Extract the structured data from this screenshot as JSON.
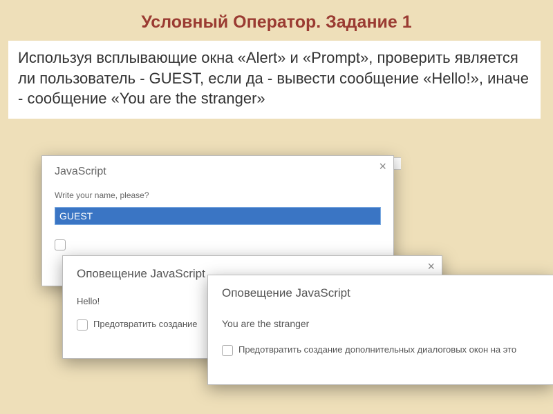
{
  "slide": {
    "title": "Условный Оператор. Задание 1",
    "task_text": "Используя  всплывающие окна «Alert» и «Prompt», проверить является ли пользователь - GUEST, если да -  вывести сообщение «Hello!», иначе - сообщение «You are the stranger»"
  },
  "prompt_dialog": {
    "title": "JavaScript",
    "label": "Write your name, please?",
    "value": "GUEST",
    "close": "×"
  },
  "alert_hello": {
    "title": "Оповещение JavaScript",
    "message": "Hello!",
    "checkbox_label": "Предотвратить создание",
    "close": "×"
  },
  "alert_stranger": {
    "title": "Оповещение JavaScript",
    "message": "You are the stranger",
    "checkbox_label": "Предотвратить создание дополнительных диалоговых окон на это"
  }
}
